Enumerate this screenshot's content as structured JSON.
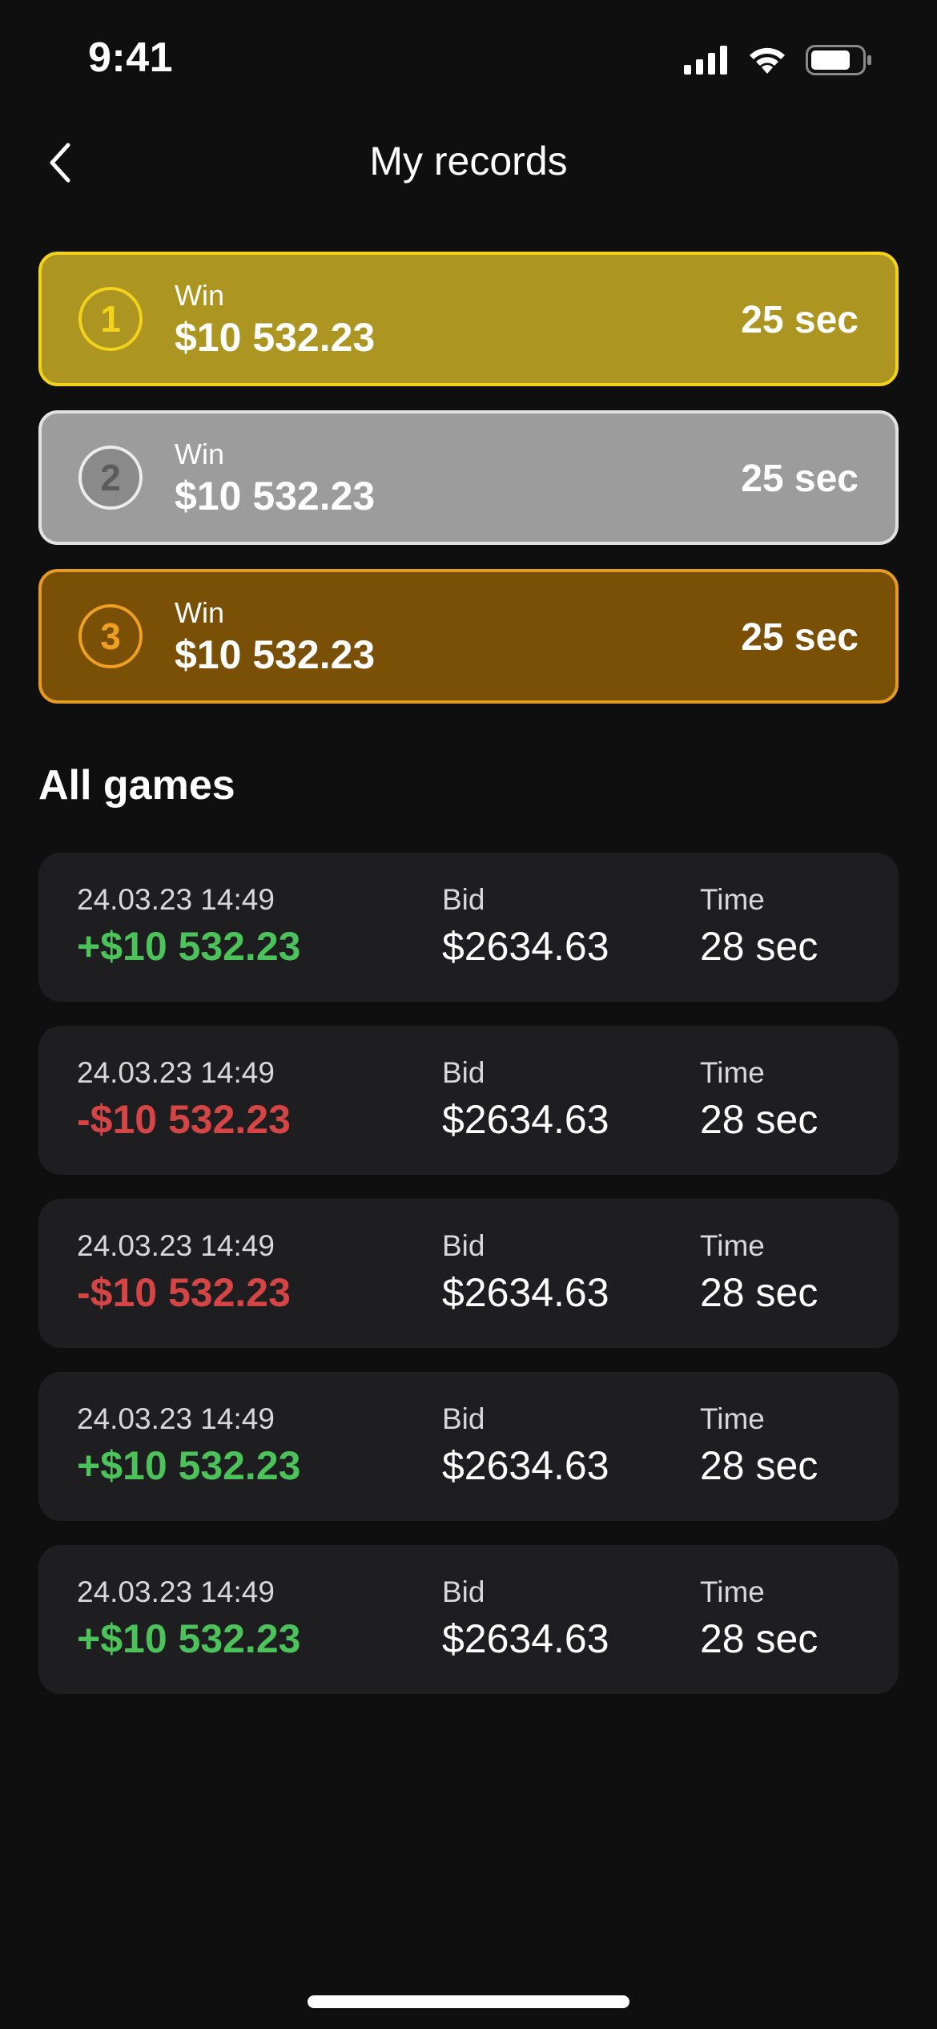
{
  "status_bar": {
    "time": "9:41",
    "icons": [
      "cellular-signal-icon",
      "wifi-icon",
      "battery-icon"
    ]
  },
  "header": {
    "back_icon": "chevron-left-icon",
    "title": "My records"
  },
  "top_records": [
    {
      "place": "1",
      "label": "Win",
      "amount": "$10 532.23",
      "time": "25 sec",
      "tier": "gold"
    },
    {
      "place": "2",
      "label": "Win",
      "amount": "$10 532.23",
      "time": "25 sec",
      "tier": "silver"
    },
    {
      "place": "3",
      "label": "Win",
      "amount": "$10 532.23",
      "time": "25 sec",
      "tier": "bronze"
    }
  ],
  "all_games": {
    "title": "All games",
    "bid_label": "Bid",
    "time_label": "Time",
    "items": [
      {
        "date": "24.03.23 14:49",
        "result": "+$10 532.23",
        "outcome": "win",
        "bid": "$2634.63",
        "time": "28 sec"
      },
      {
        "date": "24.03.23 14:49",
        "result": "-$10 532.23",
        "outcome": "loss",
        "bid": "$2634.63",
        "time": "28 sec"
      },
      {
        "date": "24.03.23 14:49",
        "result": "-$10 532.23",
        "outcome": "loss",
        "bid": "$2634.63",
        "time": "28 sec"
      },
      {
        "date": "24.03.23 14:49",
        "result": "+$10 532.23",
        "outcome": "win",
        "bid": "$2634.63",
        "time": "28 sec"
      },
      {
        "date": "24.03.23 14:49",
        "result": "+$10 532.23",
        "outcome": "win",
        "bid": "$2634.63",
        "time": "28 sec"
      }
    ]
  },
  "colors": {
    "background": "#0f0f0f",
    "gold": "#ad9521",
    "silver": "#9c9c9c",
    "bronze": "#7a5006",
    "win": "#4cc35a",
    "loss": "#d64545",
    "card": "#1e1e20"
  }
}
